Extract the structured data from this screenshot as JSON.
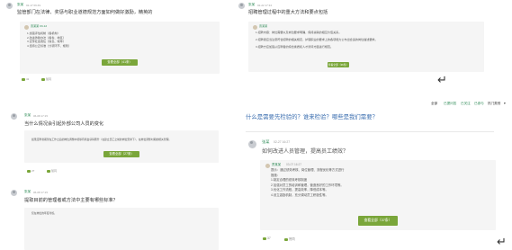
{
  "panel1": {
    "user": "张某",
    "time": "02-17 09:49",
    "question": "监管部门在法律、奖惩与职业道德规范方面如何做好激励，精英的",
    "inner_lines": [
      "1.加强评估机制（各机构）",
      "2.改进激励办法（各省、地区）",
      "3.宣传社会责任（信息、效率）",
      "4.坚持公正标准（分项环节、规则）"
    ],
    "inner_author": "贾某某 03-12",
    "button": "查看全部（41条）",
    "action1": "41",
    "action2": "赞同"
  },
  "panel2": {
    "user": "张某",
    "time": "02-22 17:34",
    "question": "招聘管理过程中的重大方法和要点包括",
    "inner_author": "贾某某",
    "inner_lines": [
      "1.招聘内容：岗位需要以及岗位要求明确，保持关联的相互价值关系。",
      "2.招聘者应当注意符合招聘的相关规定，护理职业的要求上的各项能力公布出合适的岗位描述要求。",
      "3.招聘方应加强从应聘者的综合素质和人才测评方面进行规范。"
    ],
    "button": "查看全部（36条）"
  },
  "panel3": {
    "user": "张某",
    "time": "06-08 17:15",
    "question": "当什么情况会引起外部公司人员的变化",
    "inner_lines": [
      "如果应聘者期望在工作之后的岗位调整中能够有机会获得晋升（在建立员工之前的岗位安排下），在岗位调整时期的相关管理。"
    ],
    "button": "查看全部（27条）",
    "action1": "27",
    "action2": "赞同"
  },
  "panel4": {
    "user": "张某",
    "time": "06-08 17:15",
    "question": "提取目前的管理者或方法中主要有哪些标准？",
    "inner_lines": [
      "仅在岗位的年度考核。"
    ]
  },
  "nav": {
    "links": [
      "全部",
      "已提问答",
      "已关注",
      "已参与",
      "热门类别"
    ]
  },
  "main": {
    "big_question": "什么是需要先检验的？谁来检验？哪些是我们需要？",
    "user": "张某",
    "time": "02-27 16:27",
    "question": "如何改进人员管理，提高员工绩效？",
    "inner_author": "贾某某",
    "inner_time": "03-07 16:27",
    "inner_lines": [
      "提示：通过绩效考核、岗位管理、流程优化等方式进行",
      "措施：",
      "1.制定合理的绩效考核制度",
      "2.加强对员工的培训和管理，营造良好的工作环境等。",
      "3.优化工作流程，提高效率，降低成本等。",
      "4.设立激励机制，充分调动员工积极性等。"
    ],
    "button": "查看全部（37条）",
    "action1": "37",
    "action2": "赞同"
  },
  "icons": {
    "return": "↵",
    "more": "▾"
  }
}
